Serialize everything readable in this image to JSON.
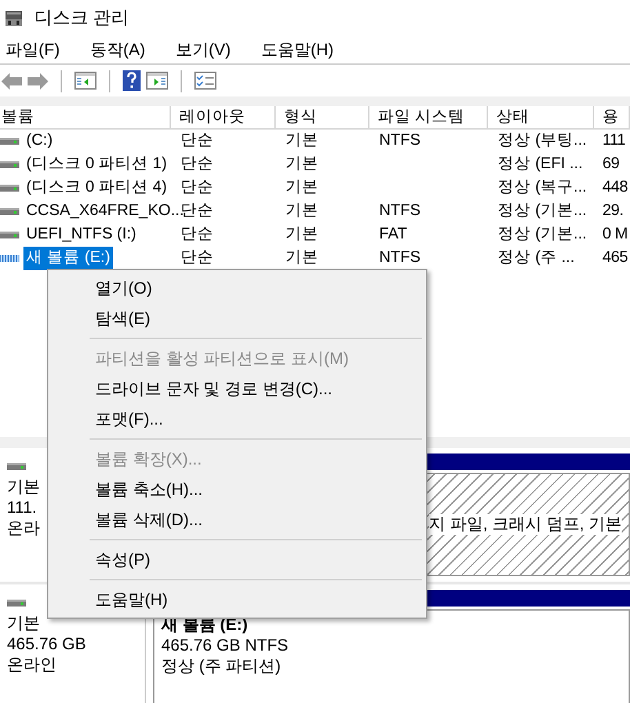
{
  "window": {
    "title": "디스크 관리"
  },
  "menu_bar": [
    "파일(F)",
    "동작(A)",
    "보기(V)",
    "도움말(H)"
  ],
  "volume_table": {
    "columns": [
      "볼륨",
      "레이아웃",
      "형식",
      "파일 시스템",
      "상태",
      "용"
    ],
    "rows": [
      {
        "cells": [
          "(C:)",
          "단순",
          "기본",
          "NTFS",
          "정상 (부팅...",
          "111"
        ],
        "selected": false,
        "kind": "drive"
      },
      {
        "cells": [
          "(디스크 0 파티션 1)",
          "단순",
          "기본",
          "",
          "정상 (EFI ...",
          "69"
        ],
        "selected": false,
        "kind": "drive"
      },
      {
        "cells": [
          "(디스크 0 파티션 4)",
          "단순",
          "기본",
          "",
          "정상 (복구...",
          "448"
        ],
        "selected": false,
        "kind": "drive"
      },
      {
        "cells": [
          "CCSA_X64FRE_KO...",
          "단순",
          "기본",
          "NTFS",
          "정상 (기본...",
          "29."
        ],
        "selected": false,
        "kind": "drive"
      },
      {
        "cells": [
          "UEFI_NTFS (I:)",
          "단순",
          "기본",
          "FAT",
          "정상 (기본...",
          "0 M"
        ],
        "selected": false,
        "kind": "drive"
      },
      {
        "cells": [
          "새 볼륨 (E:)",
          "단순",
          "기본",
          "NTFS",
          "정상 (주 ...",
          "465"
        ],
        "selected": true,
        "kind": "striped"
      }
    ]
  },
  "disks": [
    {
      "type": "기본",
      "size": "111.",
      "status": "온라",
      "partition": {
        "kind": "hatched",
        "lines": [
          "지 파일, 크래시 덤프, 기본"
        ]
      }
    },
    {
      "type": "기본",
      "size": "465.76 GB",
      "status": "온라인",
      "partition": {
        "kind": "plain",
        "title": "새 볼륨  (E:)",
        "lines": [
          "465.76 GB NTFS",
          "정상 (주 파티션)"
        ]
      }
    }
  ],
  "context_menu": [
    {
      "kind": "item",
      "label": "열기(O)",
      "disabled": false
    },
    {
      "kind": "item",
      "label": "탐색(E)",
      "disabled": false
    },
    {
      "kind": "separator"
    },
    {
      "kind": "item",
      "label": "파티션을 활성 파티션으로 표시(M)",
      "disabled": true
    },
    {
      "kind": "item",
      "label": "드라이브 문자 및 경로 변경(C)...",
      "disabled": false
    },
    {
      "kind": "item",
      "label": "포맷(F)...",
      "disabled": false
    },
    {
      "kind": "separator"
    },
    {
      "kind": "item",
      "label": "볼륨 확장(X)...",
      "disabled": true
    },
    {
      "kind": "item",
      "label": "볼륨 축소(H)...",
      "disabled": false
    },
    {
      "kind": "item",
      "label": "볼륨 삭제(D)...",
      "disabled": false
    },
    {
      "kind": "separator"
    },
    {
      "kind": "item",
      "label": "속성(P)",
      "disabled": false
    },
    {
      "kind": "separator"
    },
    {
      "kind": "item",
      "label": "도움말(H)",
      "disabled": false
    }
  ]
}
